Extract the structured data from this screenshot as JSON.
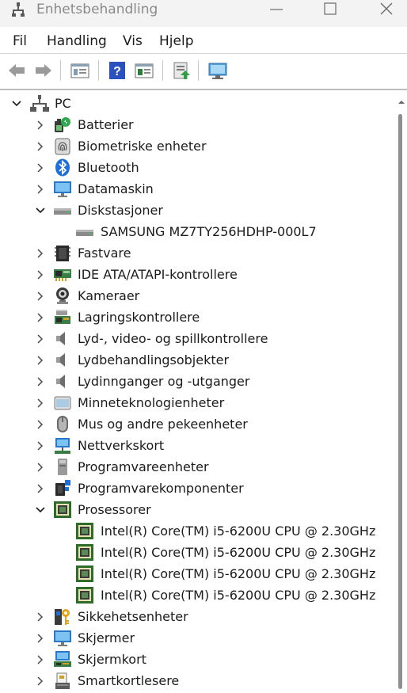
{
  "window": {
    "title": "Enhetsbehandling"
  },
  "menu": {
    "items": [
      "Fil",
      "Handling",
      "Vis",
      "Hjelp"
    ]
  },
  "toolbar": {
    "icons": [
      "back-arrow-icon",
      "forward-arrow-icon",
      "properties-icon",
      "help-icon",
      "view-icon",
      "update-driver-icon",
      "scan-hardware-icon"
    ]
  },
  "tree": {
    "root": "PC",
    "categories": [
      {
        "label": "Batterier",
        "icon": "battery-icon",
        "expanded": false
      },
      {
        "label": "Biometriske enheter",
        "icon": "fingerprint-icon",
        "expanded": false
      },
      {
        "label": "Bluetooth",
        "icon": "bluetooth-icon",
        "expanded": false
      },
      {
        "label": "Datamaskin",
        "icon": "monitor-icon",
        "expanded": false
      },
      {
        "label": "Diskstasjoner",
        "icon": "disk-drive-icon",
        "expanded": true,
        "children": [
          {
            "label": "SAMSUNG MZ7TY256HDHP-000L7",
            "icon": "disk-drive-icon"
          }
        ]
      },
      {
        "label": "Fastvare",
        "icon": "chip-icon",
        "expanded": false
      },
      {
        "label": "IDE ATA/ATAPI-kontrollere",
        "icon": "ide-controller-icon",
        "expanded": false
      },
      {
        "label": "Kameraer",
        "icon": "camera-icon",
        "expanded": false
      },
      {
        "label": "Lagringskontrollere",
        "icon": "storage-controller-icon",
        "expanded": false
      },
      {
        "label": "Lyd-, video- og spillkontrollere",
        "icon": "speaker-icon",
        "expanded": false
      },
      {
        "label": "Lydbehandlingsobjekter",
        "icon": "speaker-icon",
        "expanded": false
      },
      {
        "label": "Lydinnganger og -utganger",
        "icon": "speaker-icon",
        "expanded": false
      },
      {
        "label": "Minneteknologienheter",
        "icon": "memory-icon",
        "expanded": false
      },
      {
        "label": "Mus og andre pekeenheter",
        "icon": "mouse-icon",
        "expanded": false
      },
      {
        "label": "Nettverkskort",
        "icon": "network-icon",
        "expanded": false
      },
      {
        "label": "Programvareenheter",
        "icon": "software-device-icon",
        "expanded": false
      },
      {
        "label": "Programvarekomponenter",
        "icon": "software-component-icon",
        "expanded": false
      },
      {
        "label": "Prosessorer",
        "icon": "processor-icon",
        "expanded": true,
        "children": [
          {
            "label": "Intel(R) Core(TM) i5-6200U CPU @ 2.30GHz",
            "icon": "processor-icon"
          },
          {
            "label": "Intel(R) Core(TM) i5-6200U CPU @ 2.30GHz",
            "icon": "processor-icon"
          },
          {
            "label": "Intel(R) Core(TM) i5-6200U CPU @ 2.30GHz",
            "icon": "processor-icon"
          },
          {
            "label": "Intel(R) Core(TM) i5-6200U CPU @ 2.30GHz",
            "icon": "processor-icon"
          }
        ]
      },
      {
        "label": "Sikkehetsenheter",
        "icon": "security-key-icon",
        "expanded": false
      },
      {
        "label": "Skjermer",
        "icon": "monitor-icon",
        "expanded": false
      },
      {
        "label": "Skjermkort",
        "icon": "display-adapter-icon",
        "expanded": false
      },
      {
        "label": "Smartkortlesere",
        "icon": "smartcard-reader-icon",
        "expanded": false
      }
    ]
  },
  "colors": {
    "titlebar_bg": "#f3f3f3",
    "text": "#1b1b1b",
    "title_text": "#8a8a8a",
    "bluetooth_blue": "#1e6fd9",
    "processor_green": "#2f6b2a"
  }
}
